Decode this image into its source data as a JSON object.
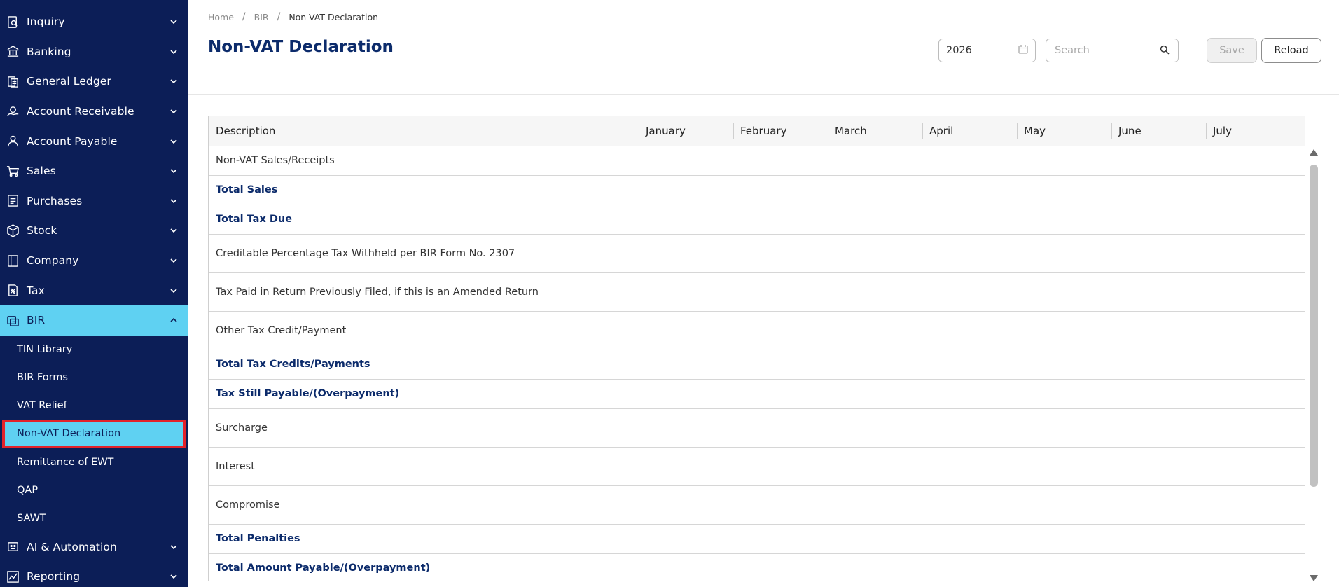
{
  "sidebar": {
    "items": [
      {
        "label": "Inquiry",
        "icon": "inquiry-icon"
      },
      {
        "label": "Banking",
        "icon": "bank-icon"
      },
      {
        "label": "General Ledger",
        "icon": "ledger-icon"
      },
      {
        "label": "Account Receivable",
        "icon": "receivable-icon"
      },
      {
        "label": "Account Payable",
        "icon": "payable-icon"
      },
      {
        "label": "Sales",
        "icon": "cart-icon"
      },
      {
        "label": "Purchases",
        "icon": "purchases-icon"
      },
      {
        "label": "Stock",
        "icon": "box-icon"
      },
      {
        "label": "Company",
        "icon": "company-icon"
      },
      {
        "label": "Tax",
        "icon": "tax-icon"
      },
      {
        "label": "BIR",
        "icon": "bir-icon"
      }
    ],
    "bir_subitems": [
      "TIN Library",
      "BIR Forms",
      "VAT Relief",
      "Non-VAT Declaration",
      "Remittance of EWT",
      "QAP",
      "SAWT"
    ],
    "bottom_items": [
      {
        "label": "AI & Automation",
        "icon": "robot-icon"
      },
      {
        "label": "Reporting",
        "icon": "chart-icon"
      }
    ]
  },
  "breadcrumb": {
    "home": "Home",
    "section": "BIR",
    "current": "Non-VAT Declaration"
  },
  "page": {
    "title": "Non-VAT Declaration"
  },
  "toolbar": {
    "year": "2026",
    "search_placeholder": "Search",
    "save_label": "Save",
    "reload_label": "Reload"
  },
  "table": {
    "headers": [
      "Description",
      "January",
      "February",
      "March",
      "April",
      "May",
      "June",
      "July"
    ],
    "rows": [
      {
        "label": "Non-VAT Sales/Receipts",
        "bold": false
      },
      {
        "label": "Total Sales",
        "bold": true
      },
      {
        "label": "Total Tax Due",
        "bold": true
      },
      {
        "label": "Creditable Percentage Tax Withheld per BIR Form No. 2307",
        "bold": false
      },
      {
        "label": "Tax Paid in Return Previously Filed, if this is an Amended Return",
        "bold": false
      },
      {
        "label": "Other Tax Credit/Payment",
        "bold": false
      },
      {
        "label": "Total Tax Credits/Payments",
        "bold": true
      },
      {
        "label": "Tax Still Payable/(Overpayment)",
        "bold": true
      },
      {
        "label": "Surcharge",
        "bold": false
      },
      {
        "label": "Interest",
        "bold": false
      },
      {
        "label": "Compromise",
        "bold": false
      },
      {
        "label": "Total Penalties",
        "bold": true
      },
      {
        "label": "Total Amount Payable/(Overpayment)",
        "bold": true
      }
    ]
  },
  "colors": {
    "sidebar_bg": "#0c1e57",
    "active_bg": "#5fd1f2",
    "title": "#0c2b6b",
    "highlight_border": "#e3222a"
  }
}
